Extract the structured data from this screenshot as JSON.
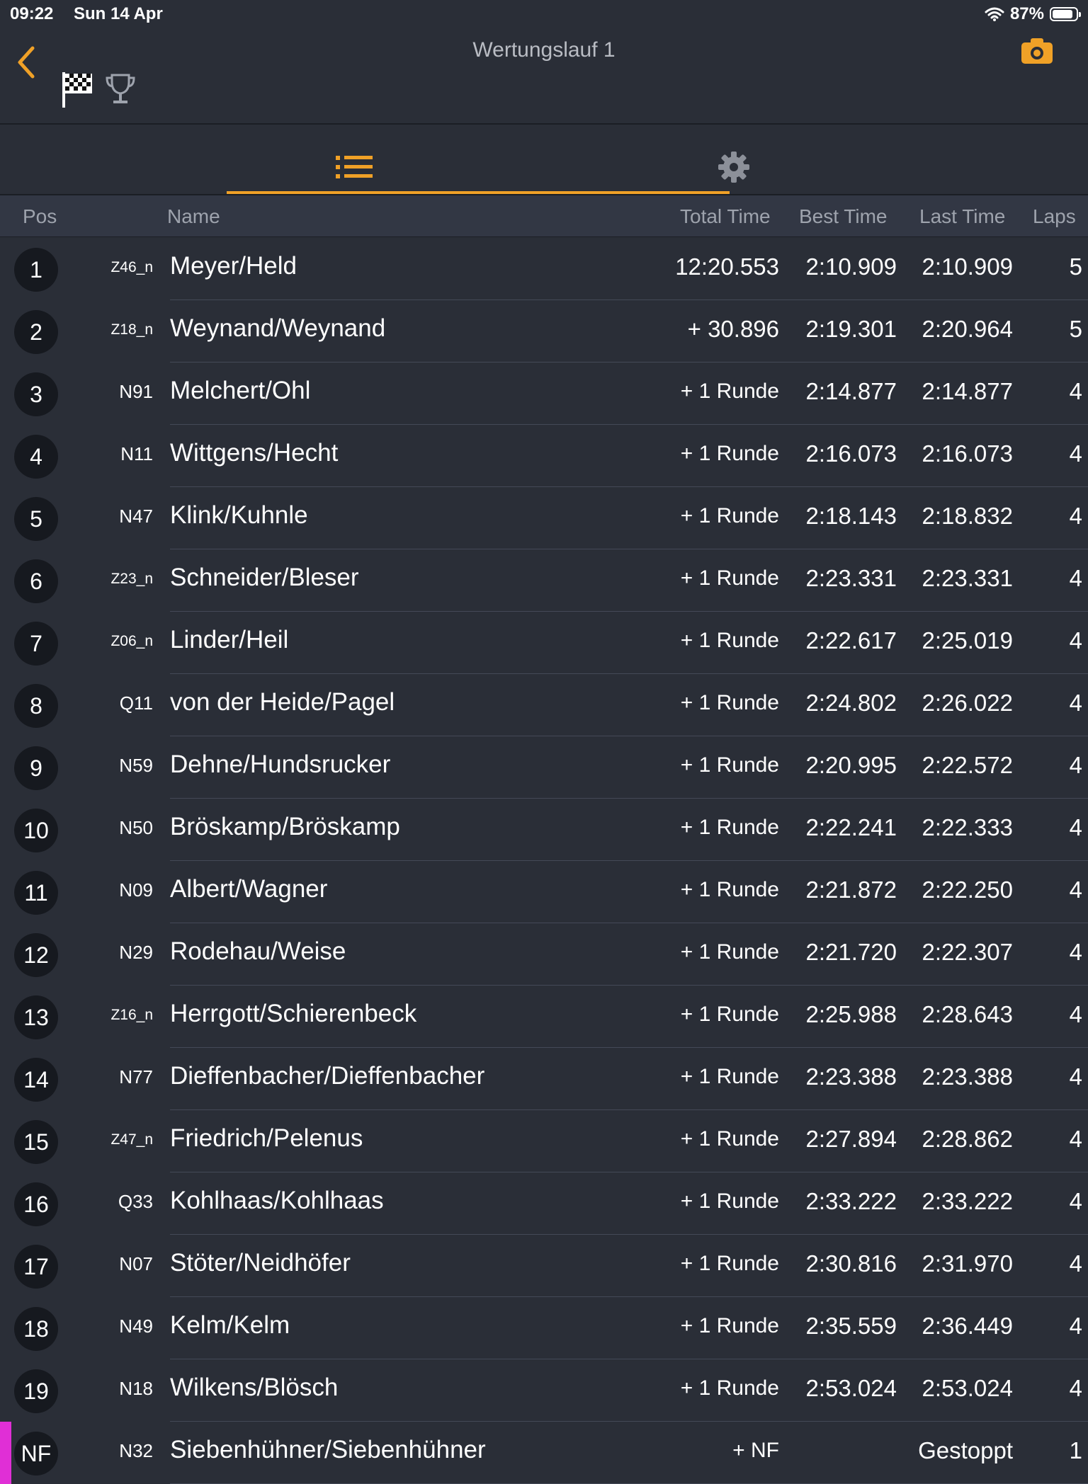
{
  "status": {
    "time": "09:22",
    "date": "Sun 14 Apr",
    "battery_percent": "87%",
    "battery_level": 0.87
  },
  "nav": {
    "title": "Wertungslauf 1"
  },
  "colors": {
    "accent": "#f0a127",
    "background": "#2a2e37",
    "badge": "#16191f",
    "dnf_marker": "#e02fd6"
  },
  "header": {
    "pos": "Pos",
    "name": "Name",
    "total": "Total Time",
    "best": "Best Time",
    "last": "Last Time",
    "laps": "Laps"
  },
  "rows": [
    {
      "pos": "1",
      "num": "Z46_n",
      "name": "Meyer/Held",
      "total": "12:20.553",
      "best": "2:10.909",
      "last": "2:10.909",
      "laps": "5"
    },
    {
      "pos": "2",
      "num": "Z18_n",
      "name": "Weynand/Weynand",
      "total": "+ 30.896",
      "best": "2:19.301",
      "last": "2:20.964",
      "laps": "5"
    },
    {
      "pos": "3",
      "num": "N91",
      "name": "Melchert/Ohl",
      "total": "+ 1 Runde",
      "best": "2:14.877",
      "last": "2:14.877",
      "laps": "4"
    },
    {
      "pos": "4",
      "num": "N11",
      "name": "Wittgens/Hecht",
      "total": "+ 1 Runde",
      "best": "2:16.073",
      "last": "2:16.073",
      "laps": "4"
    },
    {
      "pos": "5",
      "num": "N47",
      "name": "Klink/Kuhnle",
      "total": "+ 1 Runde",
      "best": "2:18.143",
      "last": "2:18.832",
      "laps": "4"
    },
    {
      "pos": "6",
      "num": "Z23_n",
      "name": "Schneider/Bleser",
      "total": "+ 1 Runde",
      "best": "2:23.331",
      "last": "2:23.331",
      "laps": "4"
    },
    {
      "pos": "7",
      "num": "Z06_n",
      "name": "Linder/Heil",
      "total": "+ 1 Runde",
      "best": "2:22.617",
      "last": "2:25.019",
      "laps": "4"
    },
    {
      "pos": "8",
      "num": "Q11",
      "name": "von der Heide/Pagel",
      "total": "+ 1 Runde",
      "best": "2:24.802",
      "last": "2:26.022",
      "laps": "4"
    },
    {
      "pos": "9",
      "num": "N59",
      "name": "Dehne/Hundsrucker",
      "total": "+ 1 Runde",
      "best": "2:20.995",
      "last": "2:22.572",
      "laps": "4"
    },
    {
      "pos": "10",
      "num": "N50",
      "name": "Bröskamp/Bröskamp",
      "total": "+ 1 Runde",
      "best": "2:22.241",
      "last": "2:22.333",
      "laps": "4"
    },
    {
      "pos": "11",
      "num": "N09",
      "name": "Albert/Wagner",
      "total": "+ 1 Runde",
      "best": "2:21.872",
      "last": "2:22.250",
      "laps": "4"
    },
    {
      "pos": "12",
      "num": "N29",
      "name": "Rodehau/Weise",
      "total": "+ 1 Runde",
      "best": "2:21.720",
      "last": "2:22.307",
      "laps": "4"
    },
    {
      "pos": "13",
      "num": "Z16_n",
      "name": "Herrgott/Schierenbeck",
      "total": "+ 1 Runde",
      "best": "2:25.988",
      "last": "2:28.643",
      "laps": "4"
    },
    {
      "pos": "14",
      "num": "N77",
      "name": "Dieffenbacher/Dieffenbacher",
      "total": "+ 1 Runde",
      "best": "2:23.388",
      "last": "2:23.388",
      "laps": "4"
    },
    {
      "pos": "15",
      "num": "Z47_n",
      "name": "Friedrich/Pelenus",
      "total": "+ 1 Runde",
      "best": "2:27.894",
      "last": "2:28.862",
      "laps": "4"
    },
    {
      "pos": "16",
      "num": "Q33",
      "name": "Kohlhaas/Kohlhaas",
      "total": "+ 1 Runde",
      "best": "2:33.222",
      "last": "2:33.222",
      "laps": "4"
    },
    {
      "pos": "17",
      "num": "N07",
      "name": "Stöter/Neidhöfer",
      "total": "+ 1 Runde",
      "best": "2:30.816",
      "last": "2:31.970",
      "laps": "4"
    },
    {
      "pos": "18",
      "num": "N49",
      "name": "Kelm/Kelm",
      "total": "+ 1 Runde",
      "best": "2:35.559",
      "last": "2:36.449",
      "laps": "4"
    },
    {
      "pos": "19",
      "num": "N18",
      "name": "Wilkens/Blösch",
      "total": "+ 1 Runde",
      "best": "2:53.024",
      "last": "2:53.024",
      "laps": "4"
    },
    {
      "pos": "NF",
      "num": "N32",
      "name": "Siebenhühner/Siebenhühner",
      "total": "+ NF",
      "best": "",
      "last": "Gestoppt",
      "laps": "1"
    }
  ]
}
